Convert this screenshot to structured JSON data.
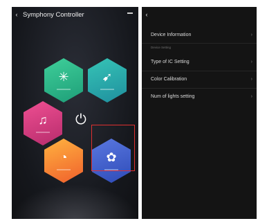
{
  "left_screen": {
    "back_icon": "chevron-left-icon",
    "title": "Symphony Controller",
    "menu_icon": "minus-icon",
    "hexes": [
      {
        "icon": "sparkle-icon",
        "glyph": "✳",
        "color": "#2fb889"
      },
      {
        "icon": "effects-icon",
        "glyph": "➹",
        "color": "#2aa9ab"
      },
      {
        "icon": "music-icon",
        "glyph": "♫",
        "color": "#d83b7e"
      },
      {
        "icon": "timer-icon",
        "glyph": "◔",
        "color": "#f5853a"
      },
      {
        "icon": "settings-gear-icon",
        "glyph": "✿",
        "color": "#3d5fcf"
      }
    ],
    "power_icon": "power-icon",
    "power_glyph": "⏻"
  },
  "right_screen": {
    "back_icon": "chevron-left-icon",
    "rows": {
      "device_information": "Device Information",
      "section_label": "Device Setting",
      "ic_setting": "Type of IC Setting",
      "color_calibration": "Color Calibration",
      "num_lights": "Num of lights setting"
    },
    "chevron": "›"
  },
  "highlight_color": "#e03030"
}
